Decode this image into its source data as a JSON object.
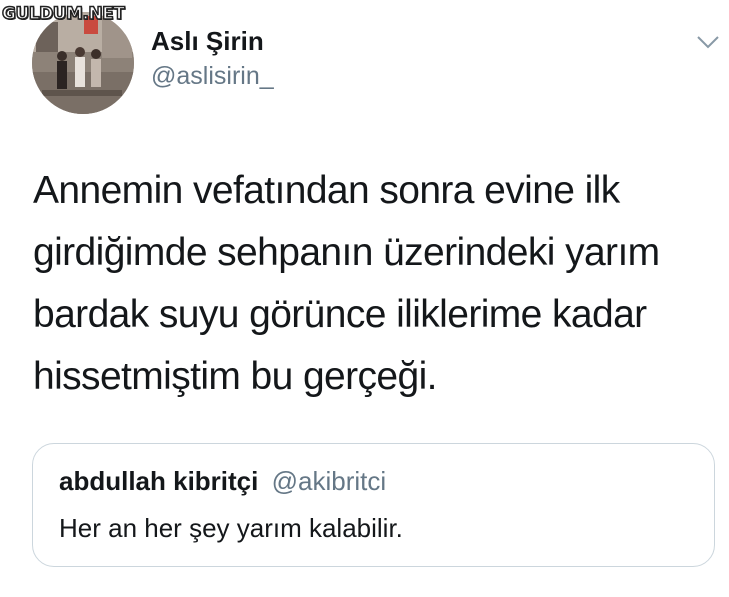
{
  "watermark": "GULDUM.NET",
  "tweet": {
    "author": {
      "display_name": "Aslı Şirin",
      "handle": "@aslisirin_",
      "avatar_icon": "profile-photo"
    },
    "menu_icon": "chevron-down-icon",
    "text": "Annemin vefatından sonra evine ilk girdiğimde sehpanın üzerindeki yarım bardak suyu görünce iliklerime kadar hissetmiştim bu gerçeği."
  },
  "quoted_tweet": {
    "author_name": "abdullah kibritçi",
    "author_handle": "@akibritci",
    "text": "Her an her şey yarım kalabilir."
  },
  "colors": {
    "primary_text": "#14171a",
    "secondary_text": "#657786",
    "border": "#ccd6dd",
    "background": "#ffffff"
  }
}
